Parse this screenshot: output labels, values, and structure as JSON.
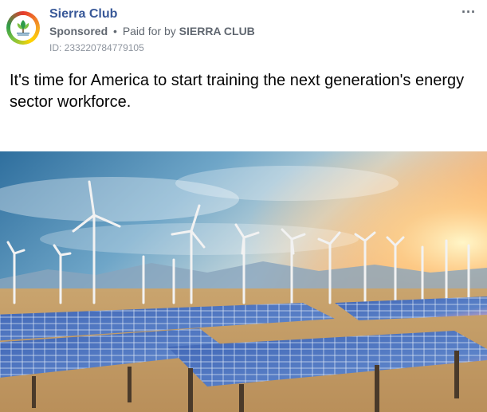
{
  "post": {
    "page_name": "Sierra Club",
    "sponsored_label": "Sponsored",
    "separator": "•",
    "paid_for_prefix": "Paid for by",
    "paid_for_name": "SIERRA CLUB",
    "ad_id": "ID: 233220784779105",
    "more_label": "···",
    "text": "It's time for America to start training the next generation's energy sector workforce.",
    "avatar_icon": "sierra-club-logo",
    "media_icon": "wind-turbines-solar-panels-photo"
  },
  "colors": {
    "page_name": "#385898",
    "meta": "#606770",
    "ad_id": "#8d949e"
  }
}
